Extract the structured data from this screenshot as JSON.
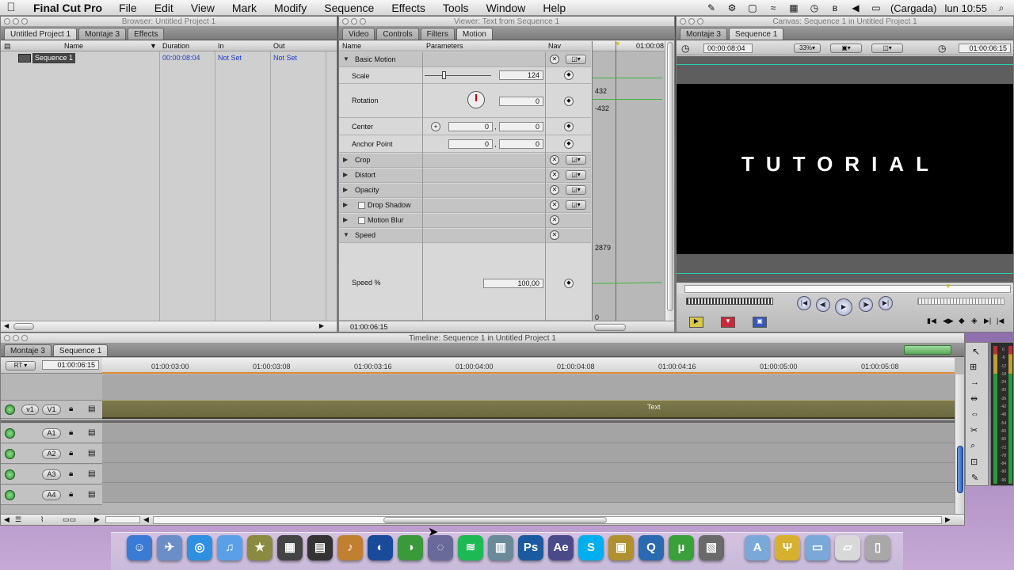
{
  "menubar": {
    "apple": "",
    "app_name": "Final Cut Pro",
    "items": [
      "File",
      "Edit",
      "View",
      "Mark",
      "Modify",
      "Sequence",
      "Effects",
      "Tools",
      "Window",
      "Help"
    ],
    "battery": "(Cargada)",
    "clock": "lun 10:55"
  },
  "browser": {
    "title": "Browser: Untitled Project 1",
    "tabs": [
      "Untitled Project 1",
      "Montaje 3",
      "Effects"
    ],
    "columns": [
      "Name",
      "Duration",
      "In",
      "Out"
    ],
    "rows": [
      {
        "name": "Sequence 1",
        "duration": "00:00:08:04",
        "in": "Not Set",
        "out": "Not Set"
      }
    ]
  },
  "viewer": {
    "title": "Viewer: Text from Sequence 1",
    "tabs": [
      "Video",
      "Controls",
      "Filters",
      "Motion"
    ],
    "columns": [
      "Name",
      "Parameters",
      "Nav"
    ],
    "ruler_time": "01:00:08",
    "basic_motion": "Basic Motion",
    "scale": {
      "label": "Scale",
      "value": "124"
    },
    "rotation": {
      "label": "Rotation",
      "value": "0",
      "graph_top": "432",
      "graph_bottom": "-432"
    },
    "center": {
      "label": "Center",
      "x": "0",
      "y": "0"
    },
    "anchor": {
      "label": "Anchor Point",
      "x": "0",
      "y": "0"
    },
    "groups": [
      "Crop",
      "Distort",
      "Opacity",
      "Drop Shadow",
      "Motion Blur",
      "Speed"
    ],
    "speed": {
      "label": "Speed %",
      "value": "100,00",
      "graph_top": "2879",
      "graph_bottom": "0"
    },
    "timecode": "01:00:06:15",
    "comma": ","
  },
  "canvas": {
    "title": "Canvas: Sequence 1 in Untitled Project 1",
    "tabs": [
      "Montaje 3",
      "Sequence 1"
    ],
    "duration": "00:00:08:04",
    "zoom": "33%",
    "timecode": "01:00:06:15",
    "text": "TUTORIAL"
  },
  "timeline": {
    "title": "Timeline: Sequence 1 in Untitled Project 1",
    "tabs": [
      "Montaje 3",
      "Sequence 1"
    ],
    "rt": "RT",
    "timecode": "01:00:06:15",
    "ruler": [
      "01:00:03:00",
      "01:00:03:08",
      "01:00:03:16",
      "01:00:04:00",
      "01:00:04:08",
      "01:00:04:16",
      "01:00:05:00",
      "01:00:05:08"
    ],
    "video_tracks": [
      {
        "src": "v1",
        "dst": "V1",
        "clip": "Text"
      }
    ],
    "audio_tracks": [
      "A1",
      "A2",
      "A3",
      "A4"
    ]
  },
  "audio_meter": {
    "labels": [
      "0",
      "-6",
      "-12",
      "-18",
      "-24",
      "-30",
      "-36",
      "-42",
      "-48",
      "-54",
      "-60",
      "-66",
      "-72",
      "-78",
      "-84",
      "-90",
      "-96"
    ]
  },
  "dock": {
    "icons": [
      {
        "name": "finder-icon",
        "glyph": "☺",
        "color": "#3a7bd5"
      },
      {
        "name": "mail-icon",
        "glyph": "✈",
        "color": "#6a8fc8"
      },
      {
        "name": "safari-icon",
        "glyph": "◎",
        "color": "#2f8fe0"
      },
      {
        "name": "itunes-icon",
        "glyph": "♫",
        "color": "#5aa0e8"
      },
      {
        "name": "imovie-star-icon",
        "glyph": "★",
        "color": "#8a8a40"
      },
      {
        "name": "final-cut-icon",
        "glyph": "▦",
        "color": "#444"
      },
      {
        "name": "clapper-icon",
        "glyph": "▤",
        "color": "#333"
      },
      {
        "name": "garageband-icon",
        "glyph": "♪",
        "color": "#c08030"
      },
      {
        "name": "globe-app-icon",
        "glyph": "◐",
        "color": "#1a4a9a"
      },
      {
        "name": "color-app-icon",
        "glyph": "◑",
        "color": "#3a9a3a"
      },
      {
        "name": "motion-icon",
        "glyph": "◌",
        "color": "#6a6a9a"
      },
      {
        "name": "spotify-icon",
        "glyph": "≋",
        "color": "#1db954"
      },
      {
        "name": "dashboard-icon",
        "glyph": "▥",
        "color": "#6a8a9a"
      },
      {
        "name": "photoshop-icon",
        "glyph": "Ps",
        "color": "#1a5aa0"
      },
      {
        "name": "after-effects-icon",
        "glyph": "Ae",
        "color": "#4a4a8a"
      },
      {
        "name": "skype-icon",
        "glyph": "S",
        "color": "#00aff0"
      },
      {
        "name": "dvd-studio-icon",
        "glyph": "▣",
        "color": "#b09030"
      },
      {
        "name": "quicktime-icon",
        "glyph": "Q",
        "color": "#2a6ab0"
      },
      {
        "name": "utorrent-icon",
        "glyph": "µ",
        "color": "#3aa03a"
      },
      {
        "name": "photo-app-icon",
        "glyph": "▧",
        "color": "#6a6a6a"
      },
      {
        "name": "applications-folder-icon",
        "glyph": "A",
        "color": "#7aa8d8"
      },
      {
        "name": "usb-drive-icon",
        "glyph": "Ψ",
        "color": "#d8b030"
      },
      {
        "name": "documents-folder-icon",
        "glyph": "▭",
        "color": "#7aa8d8"
      },
      {
        "name": "downloads-stack-icon",
        "glyph": "▱",
        "color": "#d8d8d8"
      },
      {
        "name": "trash-icon",
        "glyph": "▯",
        "color": "#a8a8a8"
      }
    ]
  }
}
